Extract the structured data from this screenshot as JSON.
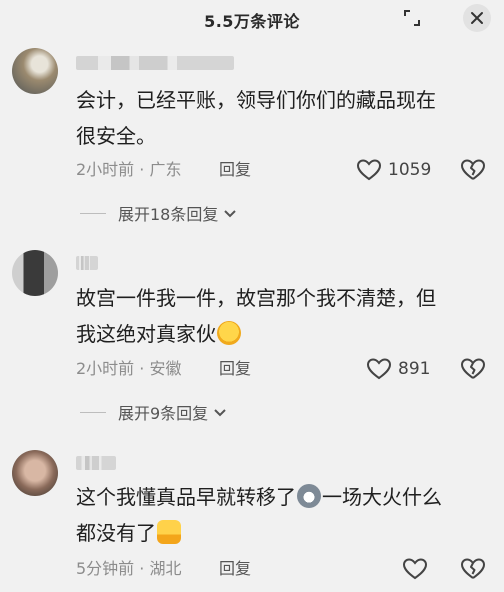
{
  "header": {
    "title": "5.5万条评论",
    "expand_icon": "expand-icon",
    "close_icon": "close-icon"
  },
  "comments": [
    {
      "text_line1": "会计，已经平账，领导们你们的藏品现在",
      "text_line2": "很安全。",
      "meta": "2小时前 · 广东",
      "reply_label": "回复",
      "likes": "1059",
      "expand_label": "展开18条回复"
    },
    {
      "text_line1": "故宫一件我一件，故宫那个我不清楚，但",
      "text_line2": "我这绝对真家伙",
      "meta": "2小时前 · 安徽",
      "reply_label": "回复",
      "likes": "891",
      "expand_label": "展开9条回复"
    },
    {
      "text_line1": "这个我懂真品早就转移了",
      "text_line1b": "一场大火什么",
      "text_line2": "都没有了",
      "meta": "5分钟前 · 湖北",
      "reply_label": "回复",
      "likes": ""
    }
  ],
  "colors": {
    "background": "#f1f1f1",
    "meta": "#8c8c8c",
    "text": "#1f1f1f"
  }
}
